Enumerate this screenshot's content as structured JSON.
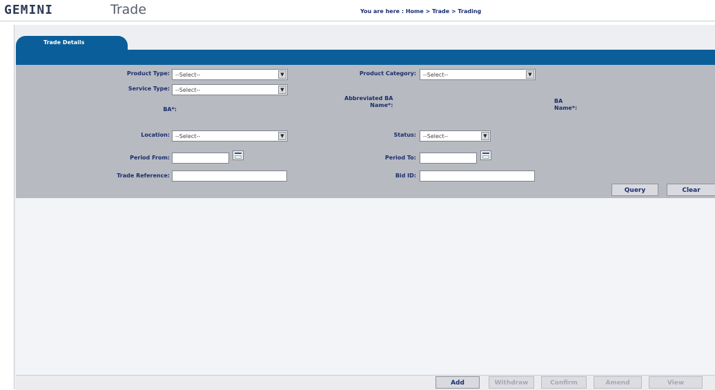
{
  "header": {
    "logo": "GEMINI",
    "title": "Trade",
    "breadcrumb": "You are here : Home > Trade > Trading"
  },
  "tabs": [
    {
      "label": "Trade Details"
    }
  ],
  "form": {
    "product_type": {
      "label": "Product Type:",
      "value": "--Select--"
    },
    "product_category": {
      "label": "Product Category:",
      "value": "--Select--"
    },
    "service_type": {
      "label": "Service Type:",
      "value": "--Select--"
    },
    "ba": {
      "label": "BA*:"
    },
    "abbreviated_ba_name": {
      "label_line1": "Abbreviated BA",
      "label_line2": "Name*:"
    },
    "ba_name": {
      "label_line1": "BA",
      "label_line2": "Name*:"
    },
    "location": {
      "label": "Location:",
      "value": "--Select--"
    },
    "status": {
      "label": "Status:",
      "value": "--Select--"
    },
    "period_from": {
      "label": "Period From:",
      "value": ""
    },
    "period_to": {
      "label": "Period To:",
      "value": ""
    },
    "trade_reference": {
      "label": "Trade Reference:",
      "value": ""
    },
    "bid_id": {
      "label": "Bid ID:",
      "value": ""
    }
  },
  "actions": {
    "query": "Query",
    "clear": "Clear"
  },
  "footer_buttons": [
    {
      "label": "Add",
      "enabled": true
    },
    {
      "label": "Withdraw",
      "enabled": false
    },
    {
      "label": "Confirm",
      "enabled": false
    },
    {
      "label": "Amend",
      "enabled": false
    },
    {
      "label": "View",
      "enabled": false
    }
  ],
  "icons": {
    "dropdown": "chevron-down-icon",
    "calendar": "calendar-icon"
  },
  "colors": {
    "tab_blue": "#0a5f9a",
    "panel_grey": "#b7bac0",
    "text_navy": "#1a2e6e"
  }
}
